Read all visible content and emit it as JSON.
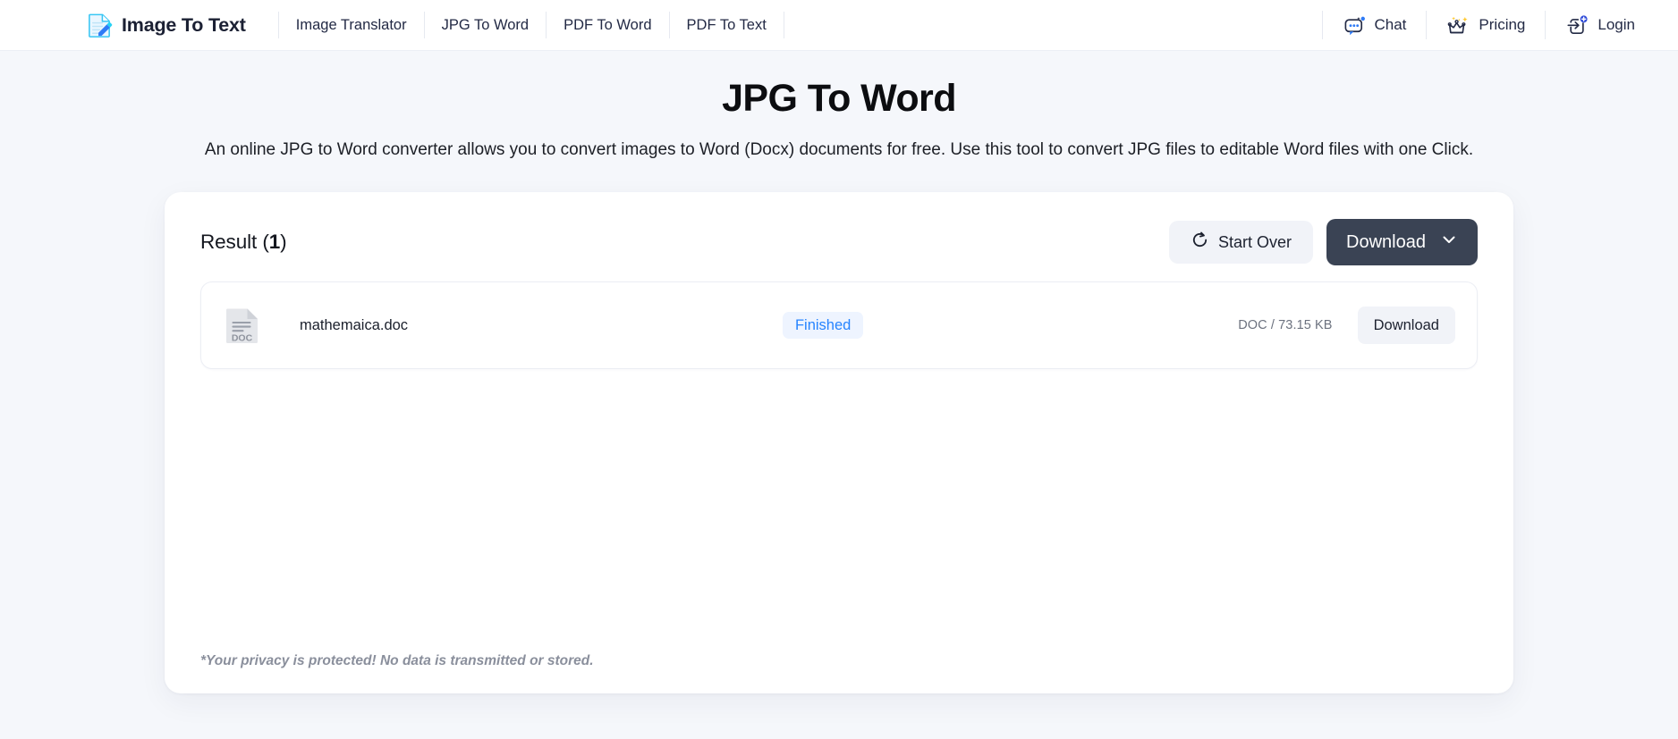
{
  "navbar": {
    "brand": {
      "label": "Image To Text",
      "icon": "document-pencil-logo"
    },
    "links": [
      {
        "label": "Image Translator"
      },
      {
        "label": "JPG To Word"
      },
      {
        "label": "PDF To Word"
      },
      {
        "label": "PDF To Text"
      }
    ],
    "actions": [
      {
        "label": "Chat",
        "icon": "chat-bubble-icon"
      },
      {
        "label": "Pricing",
        "icon": "crown-icon"
      },
      {
        "label": "Login",
        "icon": "login-arrow-icon"
      }
    ]
  },
  "hero": {
    "title": "JPG To Word",
    "subtitle": "An online JPG to Word converter allows you to convert images to Word (Docx) documents for free. Use this tool to convert JPG files to editable Word files with one Click."
  },
  "result": {
    "title_prefix": "Result (",
    "count": "1",
    "title_suffix": ")",
    "start_over_label": "Start Over",
    "download_label": "Download",
    "files": [
      {
        "name": "mathemaica.doc",
        "icon_label": "DOC",
        "status": "Finished",
        "meta": "DOC / 73.15 KB",
        "download_label": "Download"
      }
    ],
    "privacy_note": "*Your privacy is protected! No data is transmitted or stored."
  },
  "colors": {
    "page_background": "#f5f7fb",
    "accent_blue": "#2684ff",
    "badge_background": "#eef4ff",
    "download_button": "#3a4354",
    "light_button": "#f1f3f8"
  }
}
